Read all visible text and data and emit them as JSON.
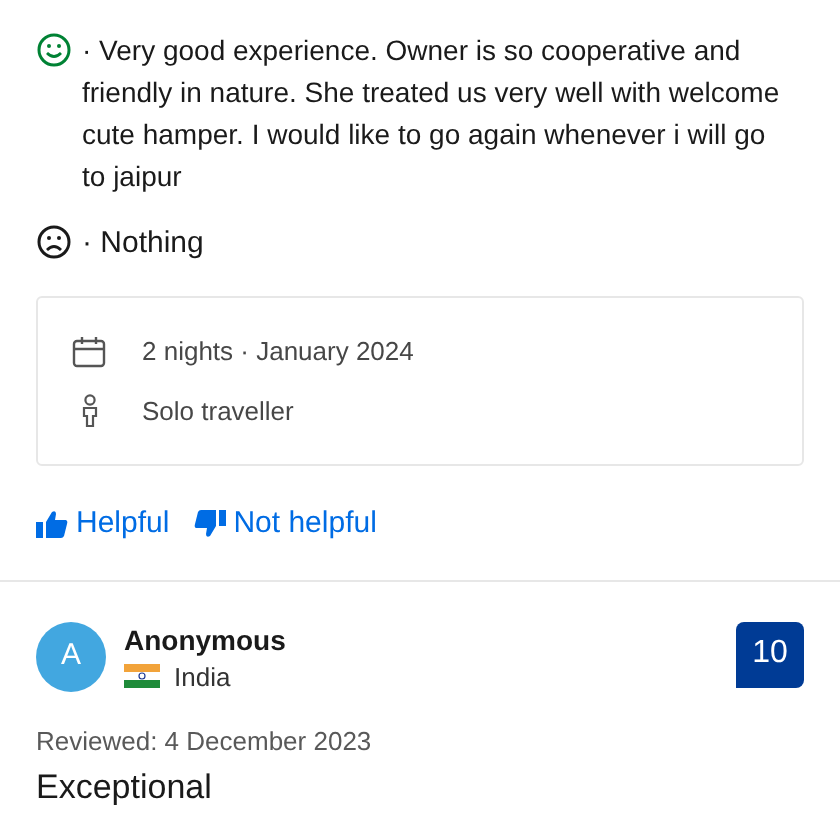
{
  "review": {
    "positive": "· Very good experience. Owner is so cooperative and friendly in nature. She treated us very well with welcome cute hamper. I would like to go again whenever i will go to jaipur",
    "negative": "· Nothing",
    "stay": [
      {
        "kind": "dates",
        "text": "2 nights · January 2024"
      },
      {
        "kind": "traveller",
        "text": "Solo traveller"
      }
    ],
    "votes": [
      {
        "kind": "up",
        "label": "Helpful"
      },
      {
        "kind": "down",
        "label": "Not helpful"
      }
    ]
  },
  "next_review": {
    "initial": "A",
    "name": "Anonymous",
    "country": "India",
    "score": "10",
    "reviewed": "Reviewed: 4 December 2023",
    "title": "Exceptional"
  }
}
